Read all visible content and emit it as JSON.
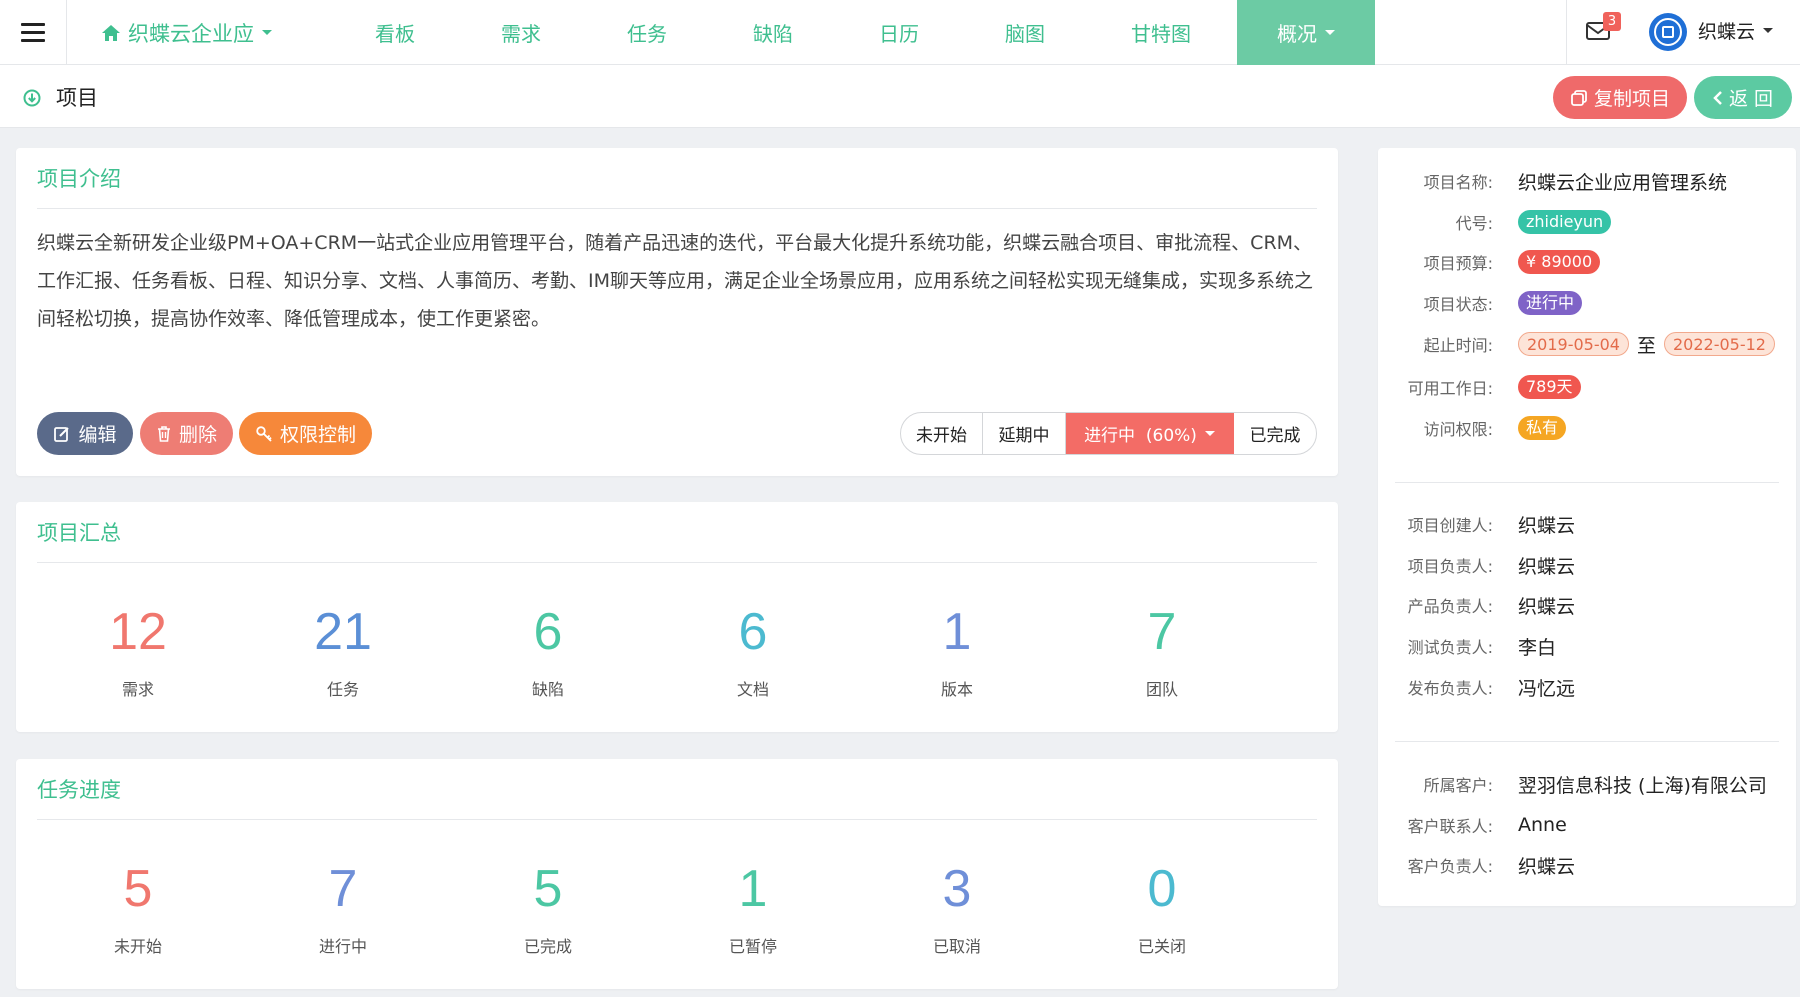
{
  "nav": {
    "brand": "织蝶云企业应",
    "tabs": [
      "看板",
      "需求",
      "任务",
      "缺陷",
      "日历",
      "脑图",
      "甘特图"
    ],
    "active_tab": "概况",
    "mail_count": "3",
    "user": "织蝶云"
  },
  "subheader": {
    "title": "项目",
    "copy_label": "复制项目",
    "back_label": "返 回"
  },
  "intro": {
    "title": "项目介绍",
    "text": "织蝶云全新研发企业级PM+OA+CRM一站式企业应用管理平台，随着产品迅速的迭代，平台最大化提升系统功能，织蝶云融合项目、审批流程、CRM、工作汇报、任务看板、日程、知识分享、文档、人事简历、考勤、IM聊天等应用，满足企业全场景应用，应用系统之间轻松实现无缝集成，实现多系统之间轻松切换，提高协作效率、降低管理成本，使工作更紧密。",
    "edit_label": "编辑",
    "delete_label": "删除",
    "permission_label": "权限控制",
    "status_options": [
      "未开始",
      "延期中",
      "进行中  (60%)",
      "已完成"
    ],
    "active_status": 2
  },
  "summary": {
    "title": "项目汇总",
    "stats": [
      {
        "value": "12",
        "label": "需求",
        "color": "#f0776e"
      },
      {
        "value": "21",
        "label": "任务",
        "color": "#5b8fd6"
      },
      {
        "value": "6",
        "label": "缺陷",
        "color": "#4cc7a3"
      },
      {
        "value": "6",
        "label": "文档",
        "color": "#4cbad0"
      },
      {
        "value": "1",
        "label": "版本",
        "color": "#6f8fd8"
      },
      {
        "value": "7",
        "label": "团队",
        "color": "#4cc7a3"
      }
    ]
  },
  "progress": {
    "title": "任务进度",
    "stats": [
      {
        "value": "5",
        "label": "未开始",
        "color": "#f0776e"
      },
      {
        "value": "7",
        "label": "进行中",
        "color": "#6f8fd8"
      },
      {
        "value": "5",
        "label": "已完成",
        "color": "#4cc7a3"
      },
      {
        "value": "1",
        "label": "已暂停",
        "color": "#4cc7a3"
      },
      {
        "value": "3",
        "label": "已取消",
        "color": "#6f8fd8"
      },
      {
        "value": "0",
        "label": "已关闭",
        "color": "#4cbad0"
      }
    ]
  },
  "info": {
    "name_label": "项目名称:",
    "name": "织蝶云企业应用管理系统",
    "code_label": "代号:",
    "code": "zhidieyun",
    "budget_label": "项目预算:",
    "budget": "¥ 89000",
    "status_label": "项目状态:",
    "status": "进行中",
    "period_label": "起止时间:",
    "start": "2019-05-04",
    "to": "至",
    "end": "2022-05-12",
    "workdays_label": "可用工作日:",
    "workdays": "789天",
    "access_label": "访问权限:",
    "access": "私有",
    "creator_label": "项目创建人:",
    "creator": "织蝶云",
    "owner_label": "项目负责人:",
    "owner": "织蝶云",
    "product_label": "产品负责人:",
    "product": "织蝶云",
    "test_label": "测试负责人:",
    "test": "李白",
    "release_label": "发布负责人:",
    "release": "冯忆远",
    "customer_label": "所属客户:",
    "customer": "翌羽信息科技 (上海)有限公司",
    "contact_label": "客户联系人:",
    "contact": "Anne",
    "cust_owner_label": "客户负责人:",
    "cust_owner": "织蝶云"
  },
  "colors": {
    "accent": "#3fbf8f",
    "active_tab": "#6ccba4",
    "danger": "#ef6a6a",
    "edit": "#5a6a8a",
    "delete": "#ee7d74",
    "permission": "#f6883a",
    "tag_code": "#35c3a7",
    "tag_budget": "#f0574f",
    "tag_status": "#7f63c7",
    "tag_workdays": "#f0574f",
    "tag_access": "#f5a623"
  }
}
